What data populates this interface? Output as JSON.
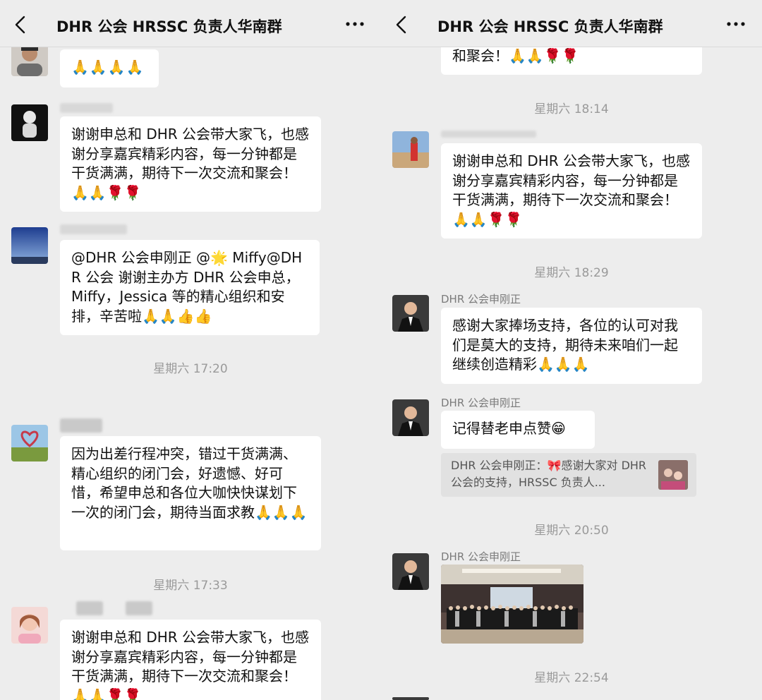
{
  "left_panel": {
    "title": "DHR 公会 HRSSC 负责人华南群(",
    "messages": [
      {
        "text": "🙏🙏🙏🙏"
      },
      {
        "text": "谢谢申总和 DHR 公会带大家飞，也感谢分享嘉宾精彩内容，每一分钟都是干货满满，期待下一次交流和聚会！🙏🙏🌹🌹"
      },
      {
        "text": "@DHR 公会申刚正 @🌟 Miffy@DHR 公会 谢谢主办方 DHR 公会申总，Miffy，Jessica 等的精心组织和安排，辛苦啦🙏🙏👍👍"
      },
      {
        "text": "因为出差行程冲突，错过干货满满、精心组织的闭门会，好遗憾、好可惜，希望申总和各位大咖快快谋划下一次的闭门会，期待当面求教🙏🙏🙏"
      },
      {
        "text": "谢谢申总和 DHR 公会带大家飞，也感谢分享嘉宾精彩内容，每一分钟都是干货满满，期待下一次交流和聚会！🙏🙏🌹🌹"
      }
    ],
    "times": [
      "星期六 17:20",
      "星期六 17:33"
    ]
  },
  "right_panel": {
    "title": "DHR 公会 HRSSC 负责人华南群(",
    "messages": [
      {
        "text": "和聚会！🙏🙏🌹🌹"
      },
      {
        "text": "谢谢申总和 DHR 公会带大家飞，也感谢分享嘉宾精彩内容，每一分钟都是干货满满，期待下一次交流和聚会！🙏🙏🌹🌹"
      },
      {
        "sender": "DHR 公会申刚正",
        "text": "感谢大家捧场支持，各位的认可对我们是莫大的支持，期待未来咱们一起继续创造精彩🙏🙏🙏"
      },
      {
        "sender": "DHR 公会申刚正",
        "text": "记得替老申点赞😁"
      },
      {
        "sender": "DHR 公会申刚正"
      }
    ],
    "quote": {
      "text": "DHR 公会申刚正：🎀感谢大家对 DHR 公会的支持，HRSSC 负责人..."
    },
    "times": [
      "星期六 18:14",
      "星期六 18:29",
      "星期六 20:50",
      "星期六 22:54"
    ]
  },
  "icons": [
    "back-chevron-icon",
    "more-dots-icon"
  ],
  "colors": {
    "background": "#ededed",
    "bubble": "#ffffff",
    "quote_bg": "#e1e1e1",
    "timestamp": "#9a9a9a"
  }
}
